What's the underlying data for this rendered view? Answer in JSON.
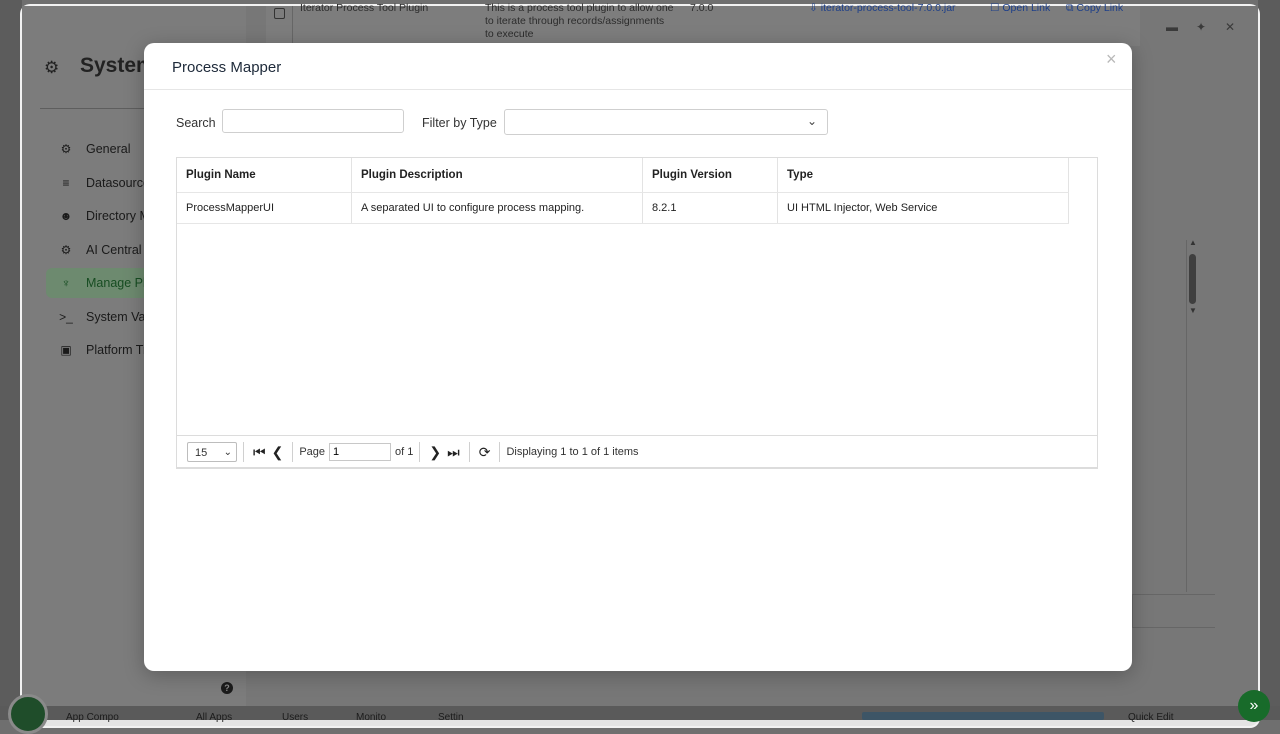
{
  "background": {
    "system_title": "System",
    "sidebar": {
      "items": [
        {
          "label": "General",
          "icon": "gear-icon"
        },
        {
          "label": "Datasource",
          "icon": "database-icon"
        },
        {
          "label": "Directory M",
          "icon": "users-icon"
        },
        {
          "label": "AI Central (",
          "icon": "gear-icon"
        },
        {
          "label": "Manage Pl",
          "icon": "plug-icon",
          "active": true
        },
        {
          "label": "System Va",
          "icon": "terminal-icon"
        },
        {
          "label": "Platform Tr",
          "icon": "id-card-icon"
        }
      ]
    },
    "table_row": {
      "name": "Iterator Process Tool Plugin",
      "description": "This is a process tool plugin to allow one to iterate through records/assignments to execute",
      "version": "7.0.0",
      "file": "iterator-process-tool-7.0.0.jar",
      "open_link": "Open Link",
      "copy_link": "Copy Link"
    },
    "bottom_bar": {
      "items": [
        "App Compo",
        "All Apps",
        "Users",
        "Monito",
        "Settin"
      ],
      "quick_edit": "Quick Edit"
    }
  },
  "modal": {
    "title": "Process Mapper",
    "close": "×",
    "search_label": "Search",
    "search_value": "",
    "filter_label": "Filter by Type",
    "filter_value": "",
    "columns": [
      "Plugin Name",
      "Plugin Description",
      "Plugin Version",
      "Type"
    ],
    "rows": [
      {
        "name": "ProcessMapperUI",
        "description": "A separated UI to configure process mapping.",
        "version": "8.2.1",
        "type": "UI HTML Injector, Web Service"
      }
    ],
    "pager": {
      "page_size": "15",
      "page_label": "Page",
      "page_value": "1",
      "of_label": "of 1",
      "status": "Displaying 1 to 1 of 1 items"
    }
  },
  "colors": {
    "accent_green": "#186b2a",
    "title_text": "#1e2a3a"
  }
}
